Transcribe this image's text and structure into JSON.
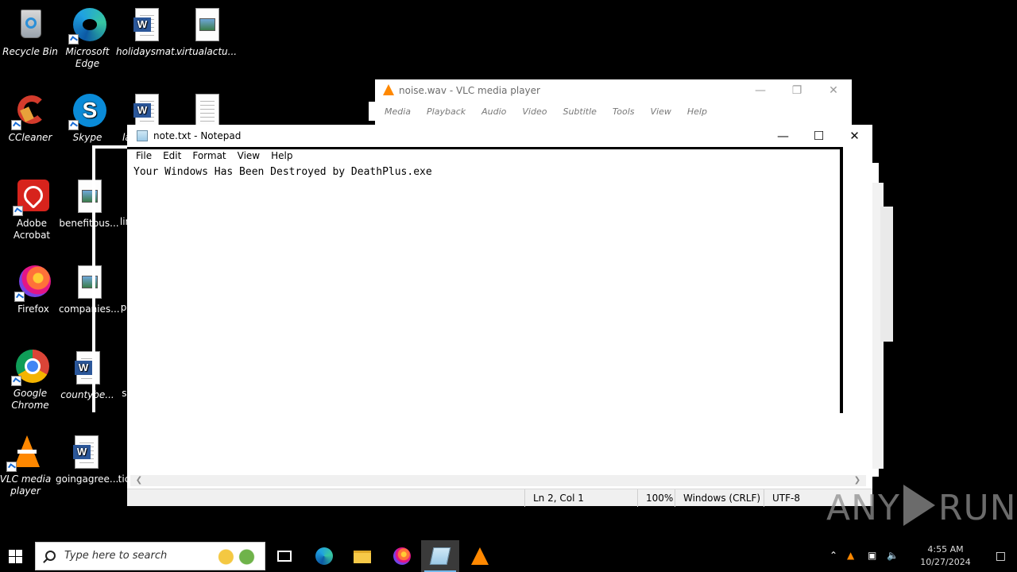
{
  "desktop": {
    "icons": [
      {
        "label": "Recycle Bin"
      },
      {
        "label": "Microsoft Edge"
      },
      {
        "label": "holidaysmat..."
      },
      {
        "label": "virtualactu..."
      },
      {
        "label": "CCleaner"
      },
      {
        "label": "Skype"
      },
      {
        "label": "la"
      },
      {
        "label": "Adobe Acrobat"
      },
      {
        "label": "benefitbus..."
      },
      {
        "label": "lin"
      },
      {
        "label": "Firefox"
      },
      {
        "label": "companies..."
      },
      {
        "label": "pr"
      },
      {
        "label": "Google Chrome"
      },
      {
        "label": "countybe..."
      },
      {
        "label": "si"
      },
      {
        "label": "VLC media player"
      },
      {
        "label": "goingagree..."
      },
      {
        "label": "tic"
      }
    ]
  },
  "vlc_window": {
    "title": "noise.wav - VLC media player",
    "menu": [
      "Media",
      "Playback",
      "Audio",
      "Video",
      "Subtitle",
      "Tools",
      "View",
      "Help"
    ]
  },
  "notepad": {
    "title": "note.txt - Notepad",
    "menu": [
      "File",
      "Edit",
      "Format",
      "View",
      "Help"
    ],
    "content": "Your Windows Has Been Destroyed by DeathPlus.exe",
    "status": {
      "position": "Ln 2, Col 1",
      "zoom": "100%",
      "line_ending": "Windows (CRLF)",
      "encoding": "UTF-8"
    }
  },
  "watermark": {
    "left": "ANY",
    "right": "RUN"
  },
  "taskbar": {
    "search_placeholder": "Type here to search",
    "clock_time": "4:55 AM",
    "clock_date": "10/27/2024"
  },
  "colors": {
    "accent": "#76b9ed",
    "vlc_orange": "#ff8800",
    "word_blue": "#2b579a"
  }
}
